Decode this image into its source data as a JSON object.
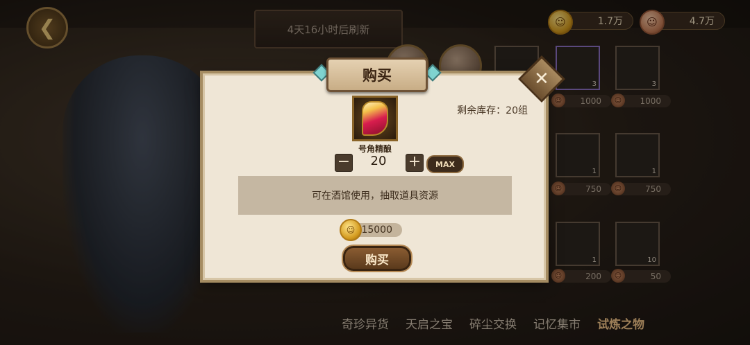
{
  "top": {
    "refresh_text": "4天16小时后刷新",
    "currency_gold": "1.7万",
    "currency_copper": "4.7万"
  },
  "modal": {
    "title": "购买",
    "item_name": "号角精酿",
    "stock_text": "剩余库存：20组",
    "quantity": "20",
    "max_label": "MAX",
    "description": "可在酒馆使用，抽取道具资源",
    "cost": "15000",
    "buy_label": "购买"
  },
  "shop": {
    "counts": [
      "3",
      "3",
      "1",
      "1",
      "1",
      "10"
    ],
    "prices": [
      "1000",
      "1000",
      "750",
      "750",
      "200",
      "50"
    ]
  },
  "tabs": [
    "奇珍异货",
    "天启之宝",
    "碎尘交换",
    "记忆集市",
    "试炼之物"
  ],
  "colors": {
    "accent": "#f2c488",
    "panel": "#efe6d6"
  }
}
